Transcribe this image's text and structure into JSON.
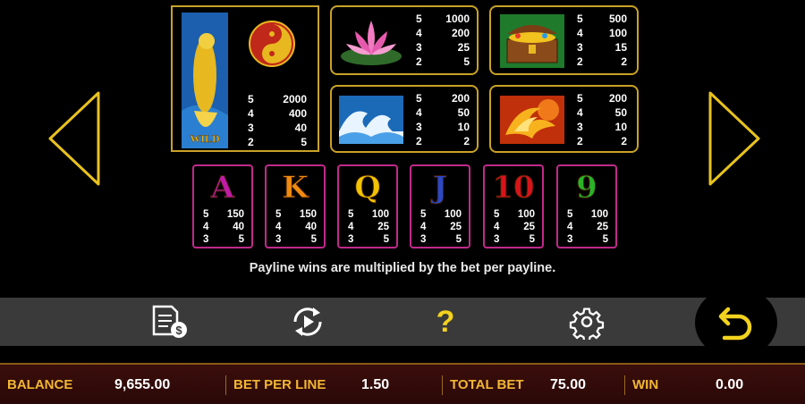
{
  "nav": {
    "prev_icon": "chevron-left-icon",
    "next_icon": "chevron-right-icon"
  },
  "wild": {
    "label": "WILD",
    "pays": [
      {
        "count": "5",
        "value": "2000"
      },
      {
        "count": "4",
        "value": "400"
      },
      {
        "count": "3",
        "value": "40"
      },
      {
        "count": "2",
        "value": "5"
      }
    ]
  },
  "symbols": {
    "lotus": {
      "icon": "lotus-icon",
      "pays": [
        {
          "count": "5",
          "value": "1000"
        },
        {
          "count": "4",
          "value": "200"
        },
        {
          "count": "3",
          "value": "25"
        },
        {
          "count": "2",
          "value": "5"
        }
      ]
    },
    "chest": {
      "icon": "treasure-chest-icon",
      "pays": [
        {
          "count": "5",
          "value": "500"
        },
        {
          "count": "4",
          "value": "100"
        },
        {
          "count": "3",
          "value": "15"
        },
        {
          "count": "2",
          "value": "2"
        }
      ]
    },
    "wave": {
      "icon": "wave-icon",
      "pays": [
        {
          "count": "5",
          "value": "200"
        },
        {
          "count": "4",
          "value": "50"
        },
        {
          "count": "3",
          "value": "10"
        },
        {
          "count": "2",
          "value": "2"
        }
      ]
    },
    "phoenix": {
      "icon": "phoenix-icon",
      "pays": [
        {
          "count": "5",
          "value": "200"
        },
        {
          "count": "4",
          "value": "50"
        },
        {
          "count": "3",
          "value": "10"
        },
        {
          "count": "2",
          "value": "2"
        }
      ]
    }
  },
  "cards": [
    {
      "letter": "A",
      "color": "#c21aa8",
      "pays": [
        {
          "count": "5",
          "value": "150"
        },
        {
          "count": "4",
          "value": "40"
        },
        {
          "count": "3",
          "value": "5"
        }
      ]
    },
    {
      "letter": "K",
      "color": "#f08a10",
      "pays": [
        {
          "count": "5",
          "value": "150"
        },
        {
          "count": "4",
          "value": "40"
        },
        {
          "count": "3",
          "value": "5"
        }
      ]
    },
    {
      "letter": "Q",
      "color": "#f2c400",
      "pays": [
        {
          "count": "5",
          "value": "100"
        },
        {
          "count": "4",
          "value": "25"
        },
        {
          "count": "3",
          "value": "5"
        }
      ]
    },
    {
      "letter": "J",
      "color": "#2a48c8",
      "pays": [
        {
          "count": "5",
          "value": "100"
        },
        {
          "count": "4",
          "value": "25"
        },
        {
          "count": "3",
          "value": "5"
        }
      ]
    },
    {
      "letter": "10",
      "color": "#d8141a",
      "pays": [
        {
          "count": "5",
          "value": "100"
        },
        {
          "count": "4",
          "value": "25"
        },
        {
          "count": "3",
          "value": "5"
        }
      ]
    },
    {
      "letter": "9",
      "color": "#28b428",
      "pays": [
        {
          "count": "5",
          "value": "100"
        },
        {
          "count": "4",
          "value": "25"
        },
        {
          "count": "3",
          "value": "5"
        }
      ]
    }
  ],
  "notice": "Payline wins are multiplied by the bet per payline.",
  "toolbar": {
    "paytable_icon": "paytable-money-icon",
    "autoplay_icon": "autoplay-icon",
    "help_label": "?",
    "settings_icon": "gear-icon",
    "back_icon": "return-arrow-icon"
  },
  "status": {
    "balance_label": "BALANCE",
    "balance_value": "9,655.00",
    "bet_label": "BET PER LINE",
    "bet_value": "1.50",
    "total_label": "TOTAL BET",
    "total_value": "75.00",
    "win_label": "WIN",
    "win_value": "0.00"
  },
  "colors": {
    "gold": "#c9a227",
    "card_border": "#c02a8a",
    "label": "#f2b632",
    "help": "#f2d21e"
  }
}
